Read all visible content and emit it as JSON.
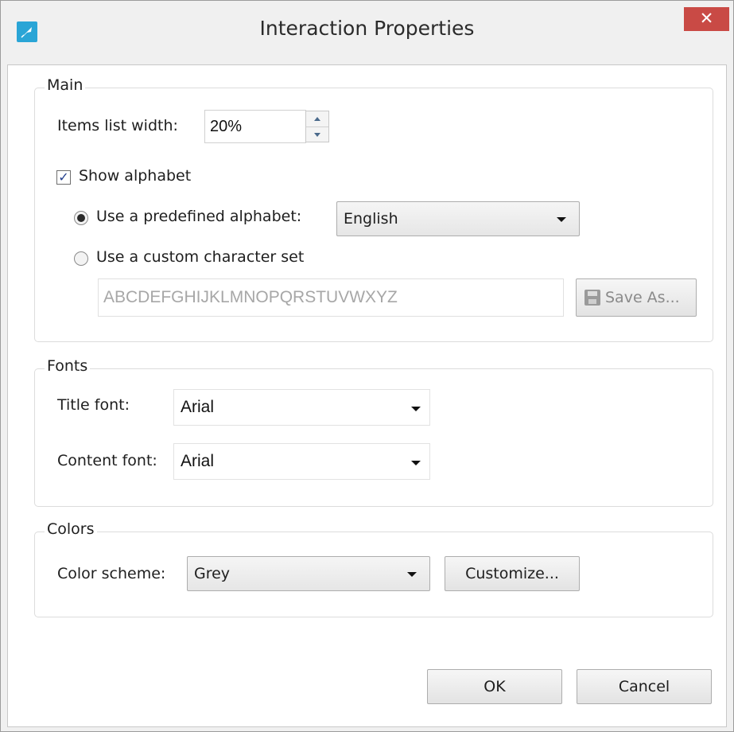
{
  "window": {
    "title": "Interaction Properties",
    "close_glyph": "✕",
    "app_icon": "feather-icon"
  },
  "main": {
    "group_label": "Main",
    "items_list_width_label": "Items list width:",
    "items_list_width_value": "20%",
    "show_alphabet_label": "Show alphabet",
    "show_alphabet_checked": true,
    "predefined_label": "Use a predefined alphabet:",
    "predefined_selected": true,
    "predefined_value": "English",
    "custom_label": "Use a custom character set",
    "custom_selected": false,
    "custom_charset_value": "ABCDEFGHIJKLMNOPQRSTUVWXYZ",
    "save_as_label": "Save As..."
  },
  "fonts": {
    "group_label": "Fonts",
    "title_font_label": "Title font:",
    "title_font_value": "Arial",
    "content_font_label": "Content font:",
    "content_font_value": "Arial"
  },
  "colors": {
    "group_label": "Colors",
    "scheme_label": "Color scheme:",
    "scheme_value": "Grey",
    "customize_label": "Customize..."
  },
  "footer": {
    "ok_label": "OK",
    "cancel_label": "Cancel"
  },
  "theme": {
    "close_red": "#c94a45",
    "app_icon_blue": "#2aa5d6",
    "disabled_text": "#a7a7a7"
  }
}
